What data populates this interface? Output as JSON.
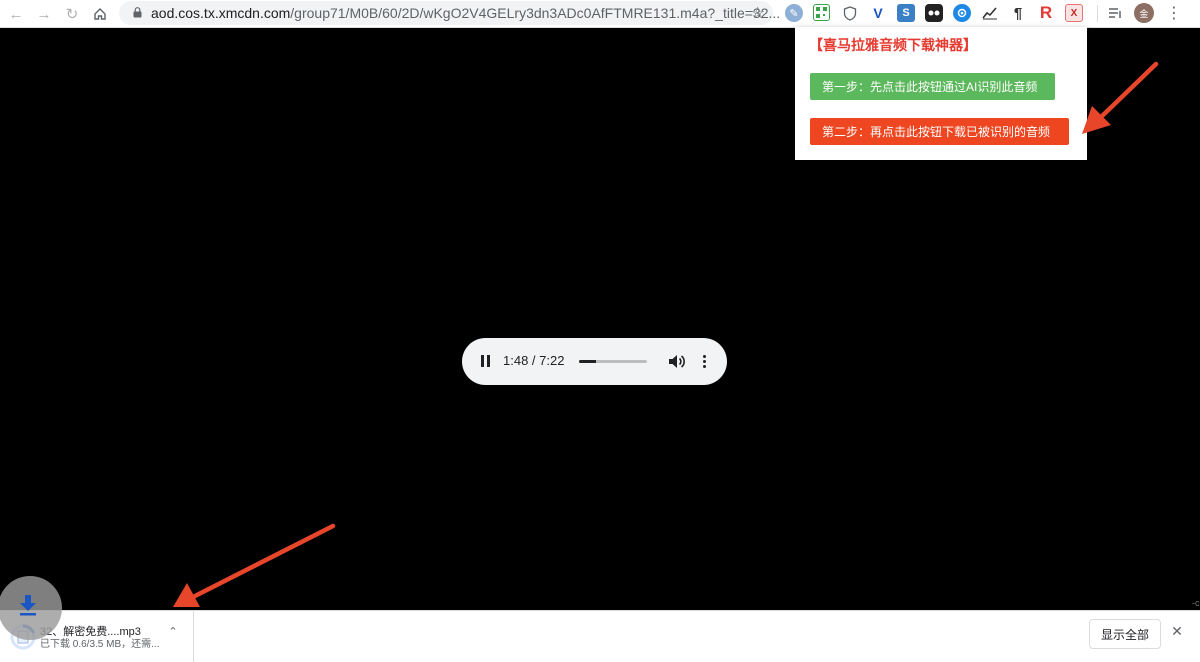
{
  "browser": {
    "url_host": "aod.cos.tx.xmcdn.com",
    "url_path": "/group71/M0B/60/2D/wKgO2V4GELry3dn3ADc0AfFTMRE131.m4a?_title=32...",
    "avatar_text": "金"
  },
  "extension_popup": {
    "title": "【喜马拉雅音频下载神器】",
    "step1_label": "第一步：先点击此按钮通过AI识别此音频",
    "step2_label": "第二步：再点击此按钮下载已被识别的音频",
    "step1_color": "#5cb85c",
    "step2_color": "#ee4621"
  },
  "audio_player": {
    "time_display": "1:48 / 7:22",
    "progress_fraction": 0.245
  },
  "download_shelf": {
    "file_name": "32、解密免费....mp3",
    "status": "已下载 0.6/3.5 MB，还需...",
    "show_all_label": "显示全部"
  },
  "colors": {
    "annotation_arrow": "#e8462b",
    "page_background": "#000000"
  },
  "right_edge_text": "-c"
}
